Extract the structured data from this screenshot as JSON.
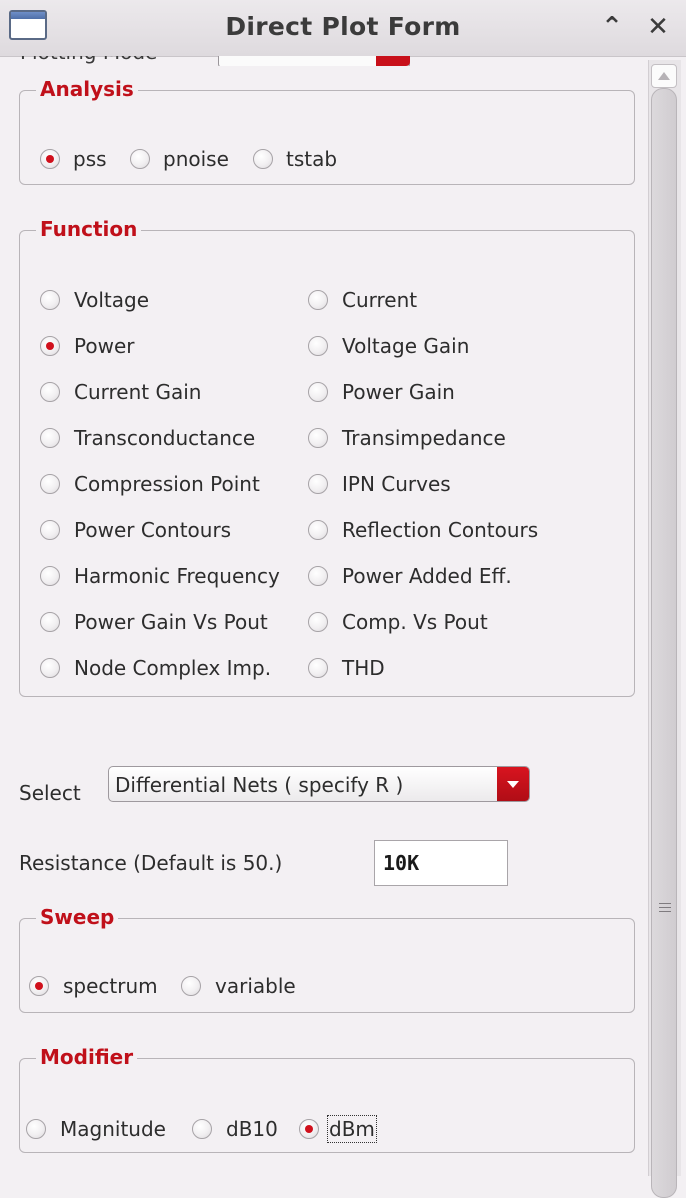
{
  "window": {
    "title": "Direct Plot Form"
  },
  "cut_row": {
    "label": "Plotting Mode"
  },
  "analysis": {
    "title": "Analysis",
    "options": [
      {
        "label": "pss",
        "selected": true
      },
      {
        "label": "pnoise",
        "selected": false
      },
      {
        "label": "tstab",
        "selected": false
      }
    ]
  },
  "function": {
    "title": "Function",
    "options": [
      {
        "label": "Voltage",
        "selected": false
      },
      {
        "label": "Current",
        "selected": false
      },
      {
        "label": "Power",
        "selected": true
      },
      {
        "label": "Voltage Gain",
        "selected": false
      },
      {
        "label": "Current Gain",
        "selected": false
      },
      {
        "label": "Power Gain",
        "selected": false
      },
      {
        "label": "Transconductance",
        "selected": false
      },
      {
        "label": "Transimpedance",
        "selected": false
      },
      {
        "label": "Compression Point",
        "selected": false
      },
      {
        "label": "IPN Curves",
        "selected": false
      },
      {
        "label": "Power Contours",
        "selected": false
      },
      {
        "label": "Reflection Contours",
        "selected": false
      },
      {
        "label": "Harmonic Frequency",
        "selected": false
      },
      {
        "label": "Power Added Eff.",
        "selected": false
      },
      {
        "label": "Power Gain Vs Pout",
        "selected": false
      },
      {
        "label": "Comp. Vs Pout",
        "selected": false
      },
      {
        "label": "Node Complex Imp.",
        "selected": false
      },
      {
        "label": "THD",
        "selected": false
      }
    ]
  },
  "select_row": {
    "label": "Select",
    "value": "Differential Nets ( specify R )"
  },
  "resistance": {
    "label": "Resistance (Default is 50.)",
    "value": "10K"
  },
  "sweep": {
    "title": "Sweep",
    "options": [
      {
        "label": "spectrum",
        "selected": true
      },
      {
        "label": "variable",
        "selected": false
      }
    ]
  },
  "modifier": {
    "title": "Modifier",
    "options": [
      {
        "label": "Magnitude",
        "selected": false
      },
      {
        "label": "dB10",
        "selected": false
      },
      {
        "label": "dBm",
        "selected": true
      }
    ]
  },
  "colors": {
    "accent": "#c0101a",
    "background": "#f3f0f3"
  }
}
